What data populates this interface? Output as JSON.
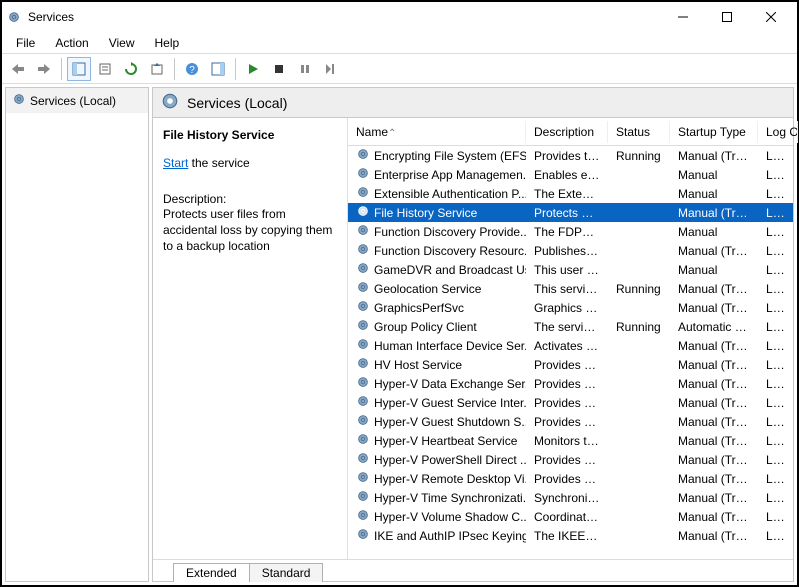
{
  "window": {
    "title": "Services"
  },
  "menu": {
    "file": "File",
    "action": "Action",
    "view": "View",
    "help": "Help"
  },
  "tree": {
    "root": "Services (Local)"
  },
  "pane": {
    "title": "Services (Local)"
  },
  "info": {
    "selected_name": "File History Service",
    "start_link": "Start",
    "start_suffix": " the service",
    "desc_label": "Description:",
    "desc_text": "Protects user files from accidental loss by copying them to a backup location"
  },
  "columns": {
    "name": "Name",
    "desc": "Description",
    "status": "Status",
    "startup": "Startup Type",
    "log": "Log On As"
  },
  "tabs": {
    "extended": "Extended",
    "standard": "Standard"
  },
  "rows": [
    {
      "name": "Encrypting File System (EFS)",
      "desc": "Provides th...",
      "status": "Running",
      "startup": "Manual (Trig...",
      "log": "Loca"
    },
    {
      "name": "Enterprise App Managemen...",
      "desc": "Enables ent...",
      "status": "",
      "startup": "Manual",
      "log": "Loca"
    },
    {
      "name": "Extensible Authentication P...",
      "desc": "The Extensi...",
      "status": "",
      "startup": "Manual",
      "log": "Loca"
    },
    {
      "name": "File History Service",
      "desc": "Protects use...",
      "status": "",
      "startup": "Manual (Trig...",
      "log": "Loca",
      "selected": true
    },
    {
      "name": "Function Discovery Provide...",
      "desc": "The FDPHO...",
      "status": "",
      "startup": "Manual",
      "log": "Loca"
    },
    {
      "name": "Function Discovery Resourc...",
      "desc": "Publishes th...",
      "status": "",
      "startup": "Manual (Trig...",
      "log": "Loca"
    },
    {
      "name": "GameDVR and Broadcast Us...",
      "desc": "This user ser...",
      "status": "",
      "startup": "Manual",
      "log": "Loca"
    },
    {
      "name": "Geolocation Service",
      "desc": "This service ...",
      "status": "Running",
      "startup": "Manual (Trig...",
      "log": "Loca"
    },
    {
      "name": "GraphicsPerfSvc",
      "desc": "Graphics pe...",
      "status": "",
      "startup": "Manual (Trig...",
      "log": "Loca"
    },
    {
      "name": "Group Policy Client",
      "desc": "The service i...",
      "status": "Running",
      "startup": "Automatic (T...",
      "log": "Loca"
    },
    {
      "name": "Human Interface Device Ser...",
      "desc": "Activates an...",
      "status": "",
      "startup": "Manual (Trig...",
      "log": "Loca"
    },
    {
      "name": "HV Host Service",
      "desc": "Provides an ...",
      "status": "",
      "startup": "Manual (Trig...",
      "log": "Loca"
    },
    {
      "name": "Hyper-V Data Exchange Ser...",
      "desc": "Provides a ...",
      "status": "",
      "startup": "Manual (Trig...",
      "log": "Loca"
    },
    {
      "name": "Hyper-V Guest Service Inter...",
      "desc": "Provides an ...",
      "status": "",
      "startup": "Manual (Trig...",
      "log": "Loca"
    },
    {
      "name": "Hyper-V Guest Shutdown S...",
      "desc": "Provides a ...",
      "status": "",
      "startup": "Manual (Trig...",
      "log": "Loca"
    },
    {
      "name": "Hyper-V Heartbeat Service",
      "desc": "Monitors th...",
      "status": "",
      "startup": "Manual (Trig...",
      "log": "Loca"
    },
    {
      "name": "Hyper-V PowerShell Direct ...",
      "desc": "Provides a ...",
      "status": "",
      "startup": "Manual (Trig...",
      "log": "Loca"
    },
    {
      "name": "Hyper-V Remote Desktop Vi...",
      "desc": "Provides a p...",
      "status": "",
      "startup": "Manual (Trig...",
      "log": "Loca"
    },
    {
      "name": "Hyper-V Time Synchronizati...",
      "desc": "Synchronize...",
      "status": "",
      "startup": "Manual (Trig...",
      "log": "Loca"
    },
    {
      "name": "Hyper-V Volume Shadow C...",
      "desc": "Coordinates...",
      "status": "",
      "startup": "Manual (Trig...",
      "log": "Loca"
    },
    {
      "name": "IKE and AuthIP IPsec Keying...",
      "desc": "The IKEEXT ...",
      "status": "",
      "startup": "Manual (Trig...",
      "log": "Loca"
    }
  ]
}
